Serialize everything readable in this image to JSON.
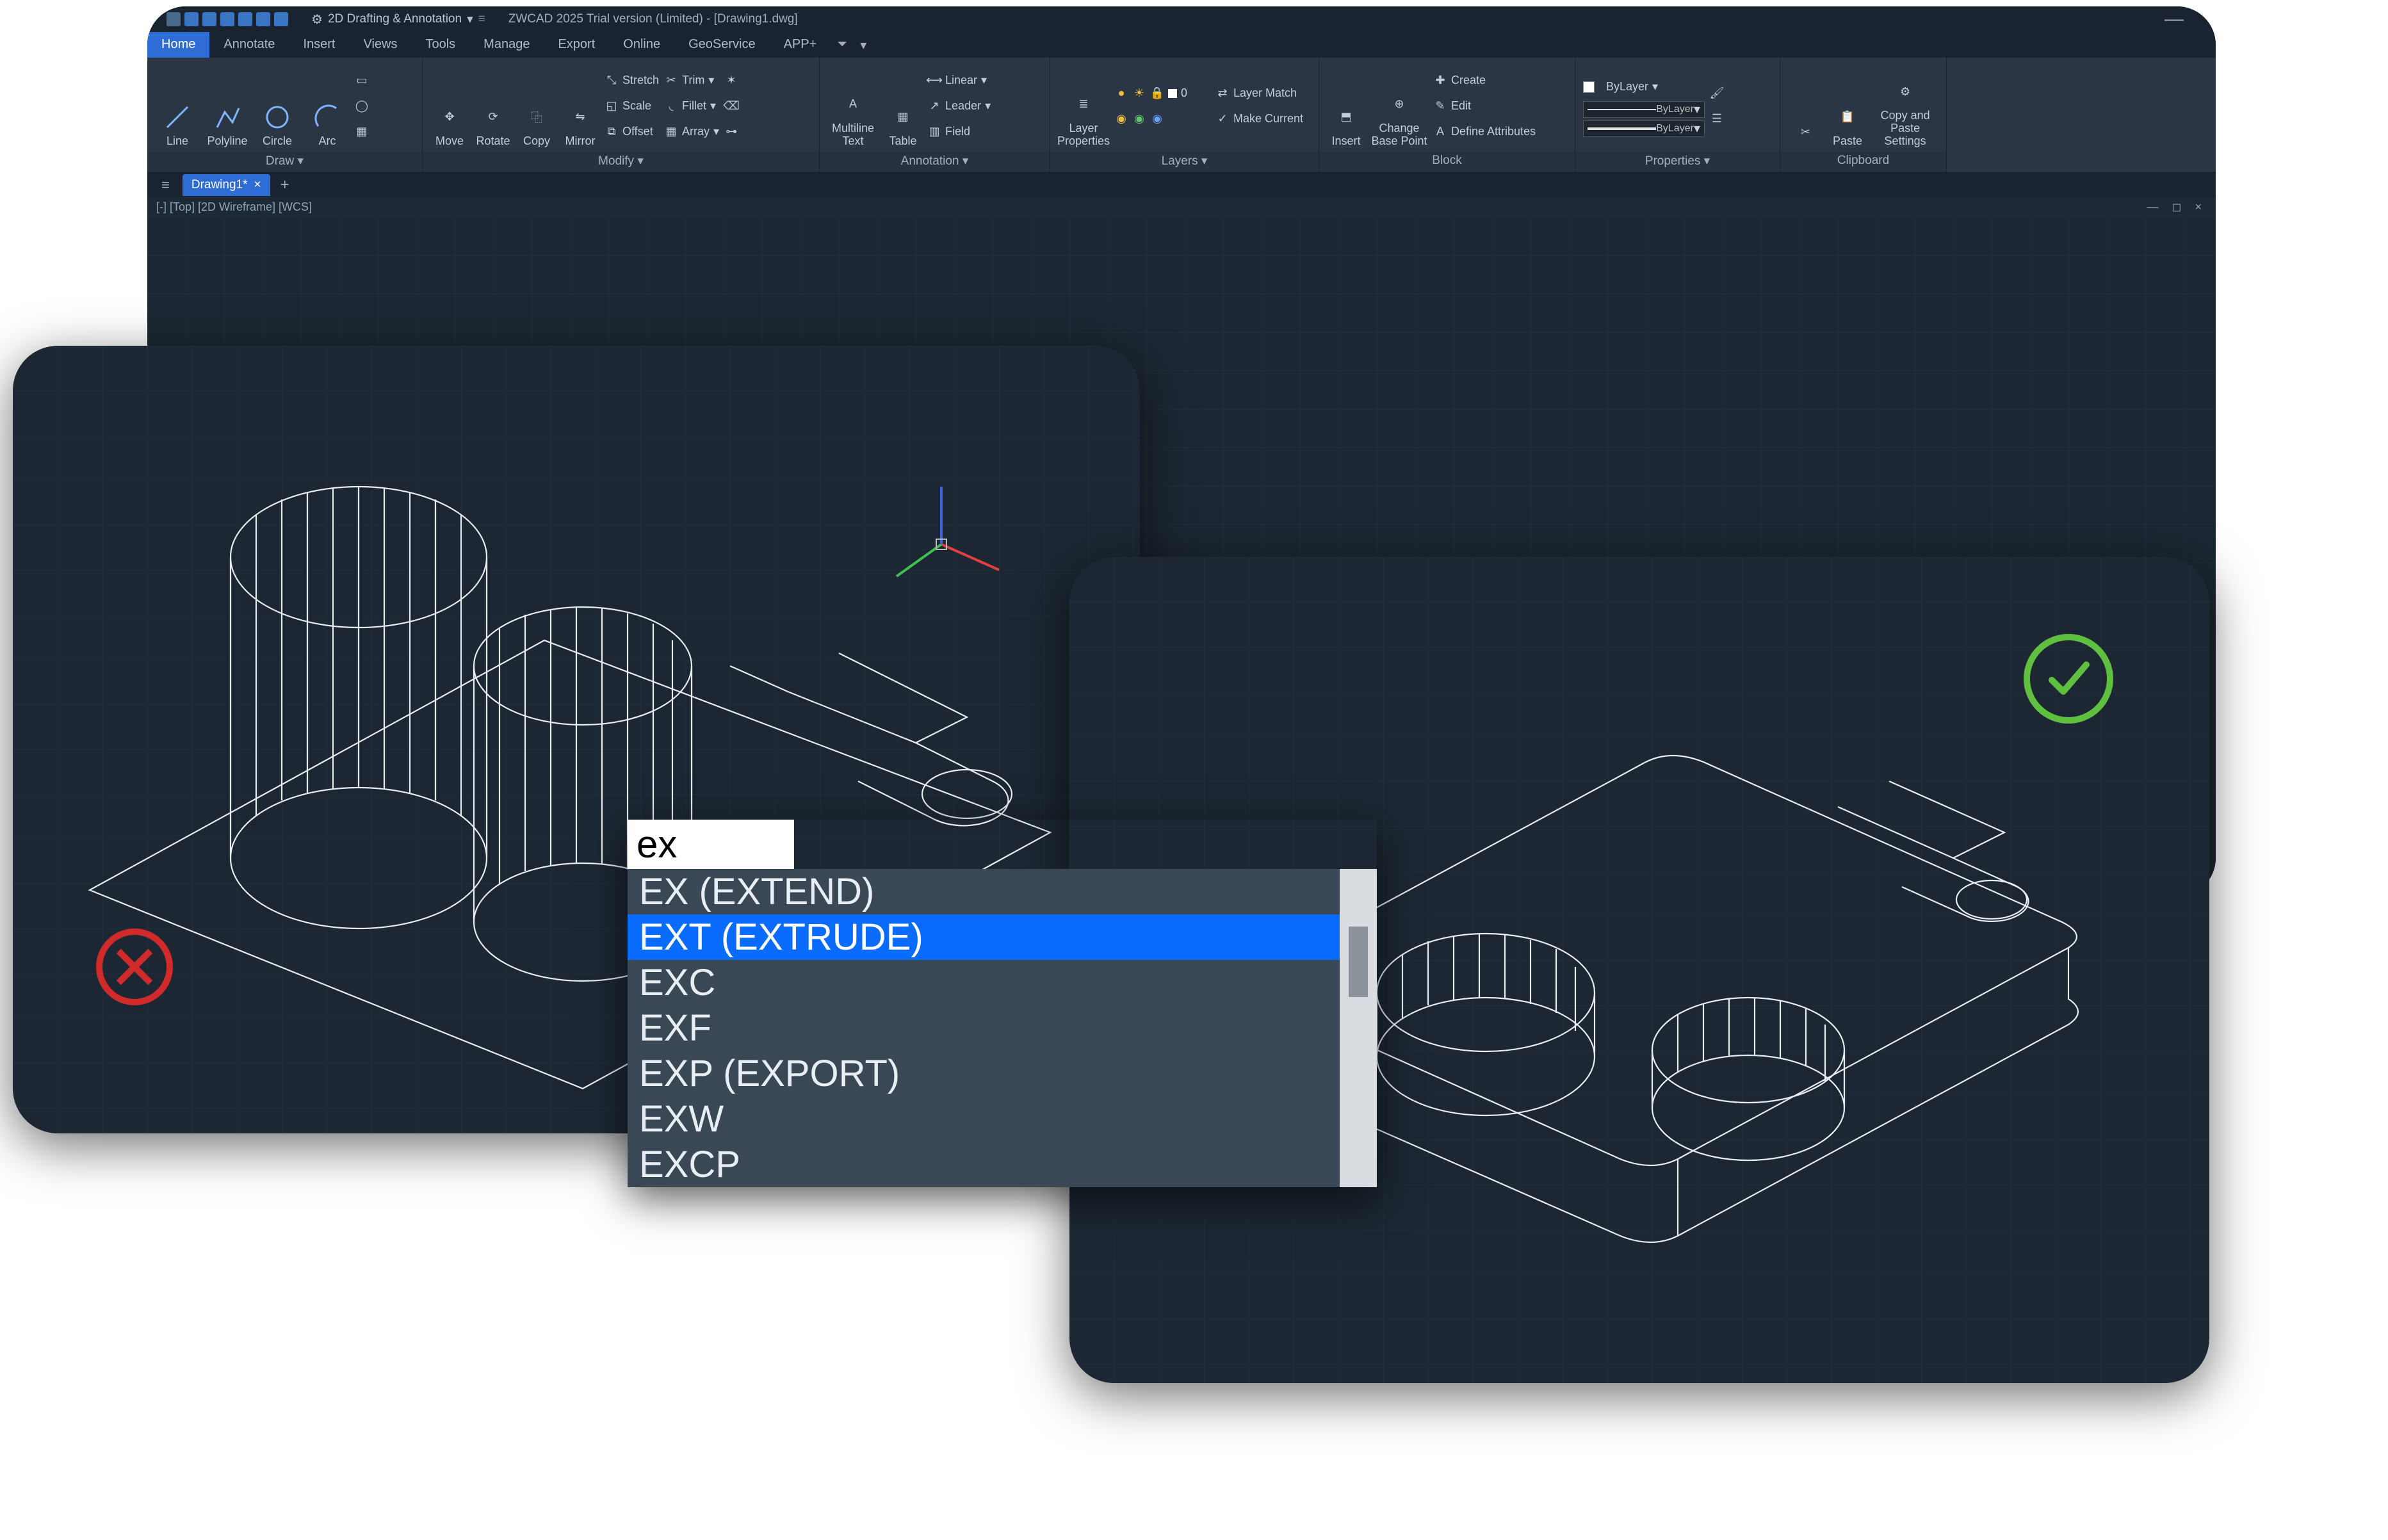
{
  "titlebar": {
    "workspace_label": "2D Drafting & Annotation",
    "app_title": "ZWCAD 2025 Trial version (Limited) - [Drawing1.dwg]"
  },
  "tabs": {
    "items": [
      "Home",
      "Annotate",
      "Insert",
      "Views",
      "Tools",
      "Manage",
      "Export",
      "Online",
      "GeoService",
      "APP+"
    ],
    "active": "Home"
  },
  "ribbon": {
    "draw": {
      "title": "Draw",
      "line": "Line",
      "polyline": "Polyline",
      "circle": "Circle",
      "arc": "Arc"
    },
    "modify": {
      "title": "Modify",
      "move": "Move",
      "rotate": "Rotate",
      "copy": "Copy",
      "mirror": "Mirror",
      "stretch": "Stretch",
      "scale": "Scale",
      "offset": "Offset",
      "trim": "Trim",
      "fillet": "Fillet",
      "array": "Array"
    },
    "annotation": {
      "title": "Annotation",
      "mtext": "Multiline Text",
      "table": "Table",
      "linear": "Linear",
      "leader": "Leader",
      "field": "Field"
    },
    "layers": {
      "title": "Layers",
      "layerprops": "Layer Properties",
      "match": "Layer Match",
      "current": "Make Current",
      "layer_name": "0"
    },
    "block": {
      "title": "Block",
      "insert": "Insert",
      "change": "Change Base Point",
      "create": "Create",
      "edit": "Edit",
      "define": "Define Attributes"
    },
    "properties": {
      "title": "Properties",
      "bylayer": "ByLayer"
    },
    "clipboard": {
      "title": "Clipboard",
      "paste": "Paste",
      "copypaste": "Copy and Paste Settings"
    }
  },
  "doc_tab": {
    "name": "Drawing1*"
  },
  "viewport_label": "[-] [Top] [2D Wireframe] [WCS]",
  "command": {
    "input": "ex",
    "suggestions": [
      "EX (EXTEND)",
      "EXT (EXTRUDE)",
      "EXC",
      "EXF",
      "EXP (EXPORT)",
      "EXW",
      "EXCP"
    ],
    "selected_index": 1
  }
}
